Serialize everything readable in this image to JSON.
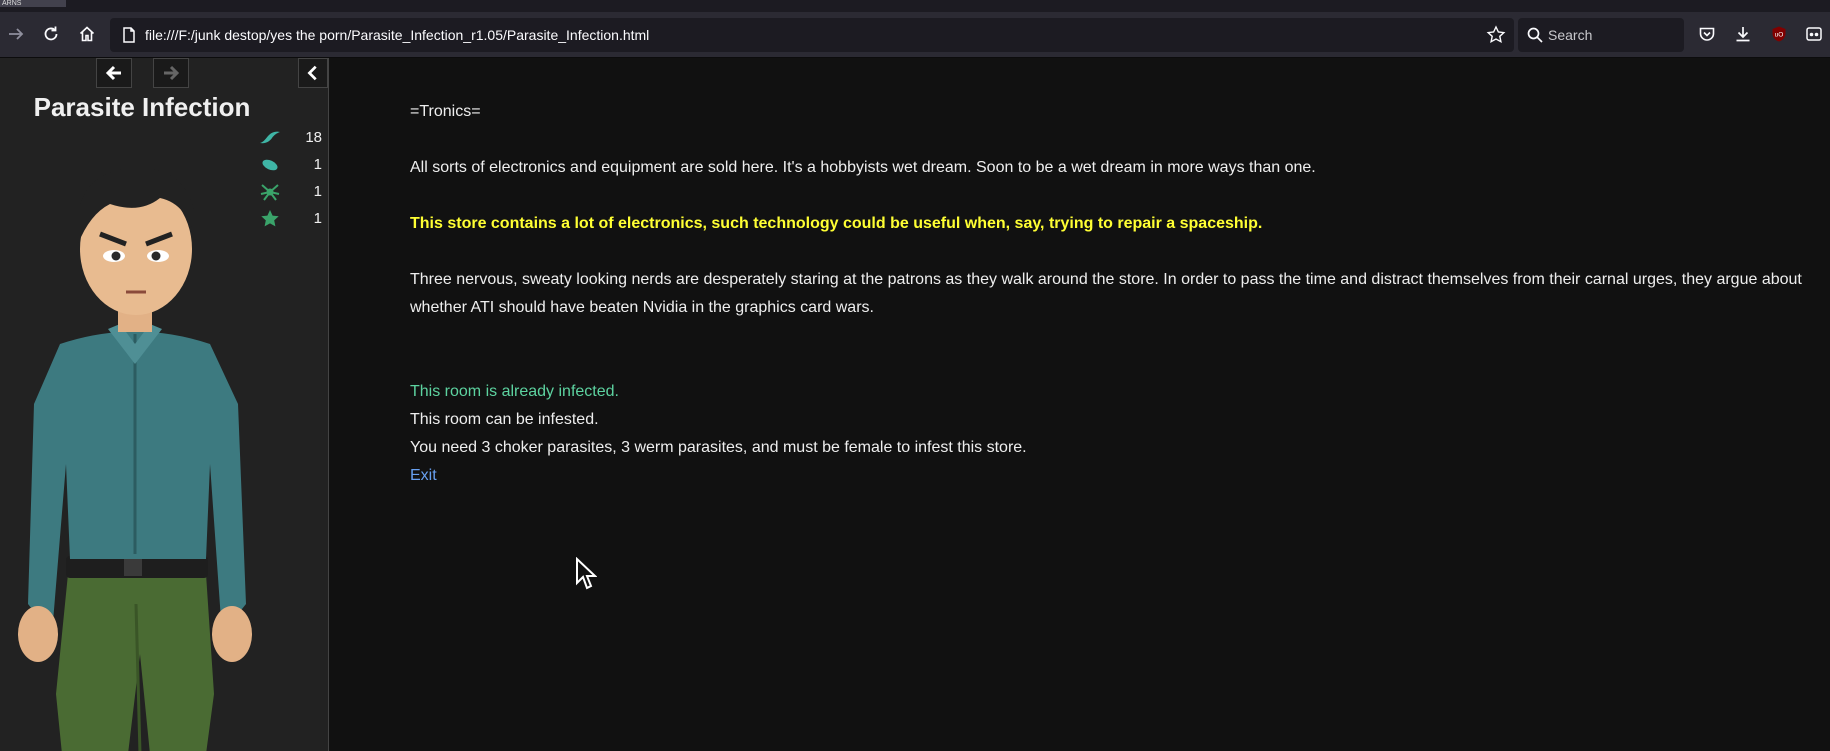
{
  "browser": {
    "url": "file:///F:/junk destop/yes the porn/Parasite_Infection_r1.05/Parasite_Infection.html",
    "search_placeholder": "Search",
    "tab_label": "ARNS"
  },
  "sidebar": {
    "story_title": "Parasite Infection",
    "stats": [
      {
        "icon": "choker-parasite-icon",
        "value": "18",
        "color": "#3fb5a6"
      },
      {
        "icon": "werm-parasite-icon",
        "value": "1",
        "color": "#3fb5a6"
      },
      {
        "icon": "spider-parasite-icon",
        "value": "1",
        "color": "#3aa36a"
      },
      {
        "icon": "star-parasite-icon",
        "value": "1",
        "color": "#3aa36a"
      }
    ]
  },
  "passage": {
    "heading": "=Tronics=",
    "description": "All sorts of electronics and equipment are sold here. It's a hobbyists wet dream. Soon to be a wet dream in more ways than one.",
    "hint": "This store contains a lot of electronics, such technology could be useful when, say, trying to repair a spaceship.",
    "nerds": "Three nervous, sweaty looking nerds are desperately staring at the patrons as they walk around the store. In order to pass the time and distract themselves from their carnal urges, they argue about whether ATI should have beaten Nvidia in the graphics card wars.",
    "infected_status": "This room is already infected.",
    "infest_status": "This room can be infested.",
    "requirements": "You need 3 choker parasites, 3 werm parasites, and must be female to infest this store.",
    "exit_label": "Exit"
  },
  "colors": {
    "hint": "#ffff33",
    "infected": "#5dd3a0",
    "link": "#68a0f0",
    "background": "#111111",
    "sidebar": "#222222"
  }
}
